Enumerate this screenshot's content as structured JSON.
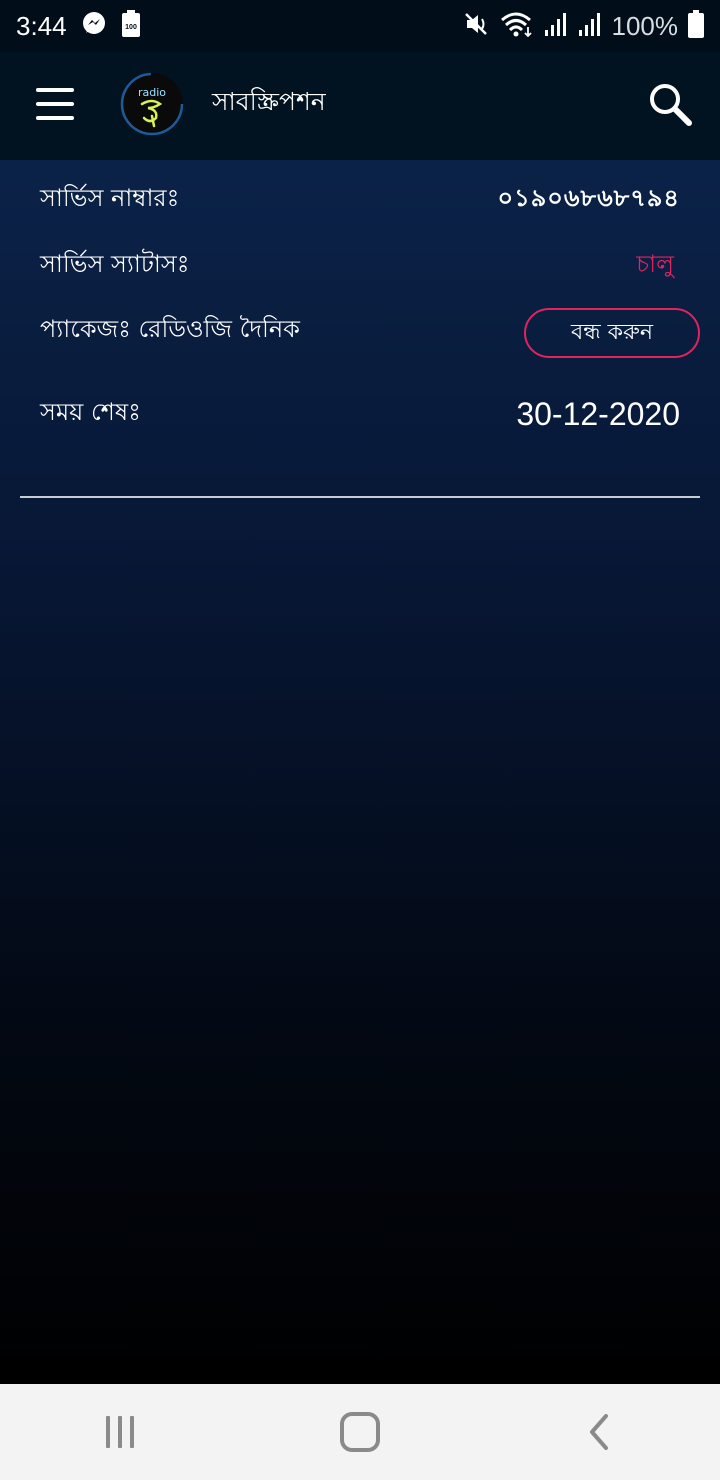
{
  "status_bar": {
    "time": "3:44",
    "battery_text": "100%",
    "icons": [
      "messenger-icon",
      "battery-saver-icon",
      "mute-icon",
      "wifi-icon",
      "signal-icon",
      "signal-icon",
      "battery-icon"
    ]
  },
  "app_bar": {
    "title": "সাবস্ক্রিপশন",
    "logo_text": "radio",
    "icons": [
      "menu-icon",
      "search-icon"
    ]
  },
  "subscription": {
    "service_number_label": "সার্ভিস নাম্বারঃ",
    "service_number_value": "০১৯০৬৮৬৮৭৯৪",
    "service_status_label": "সার্ভিস স্যাটাসঃ",
    "service_status_value": "চালু",
    "package_label": "প্যাকেজঃ রেডিওজি দৈনিক",
    "stop_button_label": "বন্ধ করুন",
    "expiry_label": "সময় শেষঃ",
    "expiry_value": "30-12-2020"
  },
  "colors": {
    "accent": "#e0245e",
    "appbar_bg": "#011220",
    "content_top": "#0b2248",
    "navbar_bg": "#f3f3f3"
  },
  "nav_bar": {
    "icons": [
      "recent-apps-icon",
      "home-icon",
      "back-icon"
    ]
  }
}
